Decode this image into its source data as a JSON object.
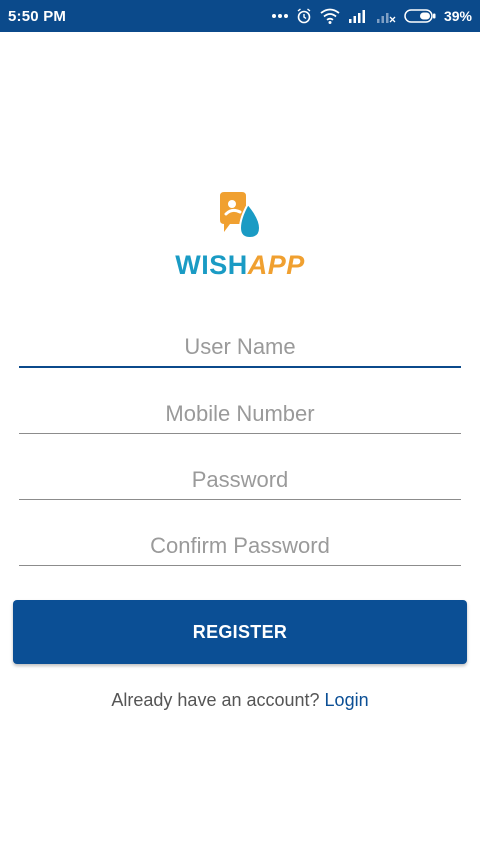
{
  "status_bar": {
    "time": "5:50 PM",
    "battery_percent": "39%",
    "icons": [
      "more-dots-icon",
      "alarm-clock-icon",
      "wifi-icon",
      "signal-icon",
      "no-signal-icon",
      "battery-icon"
    ]
  },
  "logo": {
    "text_part1": "WISH",
    "text_part2": "APP",
    "colors": {
      "part1": "#1a9bc4",
      "part2": "#f0a030"
    }
  },
  "form": {
    "username": {
      "placeholder": "User Name",
      "value": ""
    },
    "mobile": {
      "placeholder": "Mobile Number",
      "value": ""
    },
    "password": {
      "placeholder": "Password",
      "value": ""
    },
    "confirm_password": {
      "placeholder": "Confirm Password",
      "value": ""
    }
  },
  "actions": {
    "register_label": "REGISTER",
    "login_prompt": "Already have an account? ",
    "login_label": "Login"
  },
  "colors": {
    "primary": "#0b4f95",
    "status_bar": "#0b4a8b"
  }
}
